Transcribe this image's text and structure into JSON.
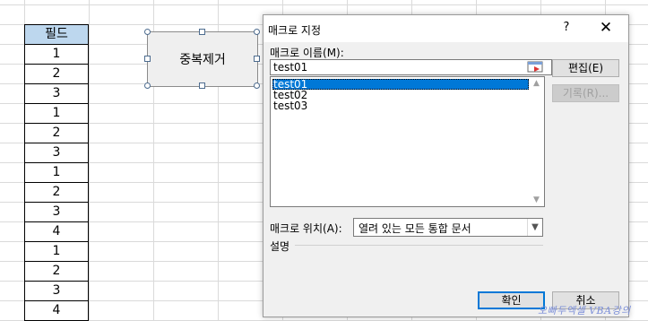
{
  "sheet": {
    "field_header": "필드",
    "field_values": [
      "1",
      "2",
      "3",
      "1",
      "2",
      "3",
      "1",
      "2",
      "3",
      "4",
      "1",
      "2",
      "3",
      "4"
    ]
  },
  "shape": {
    "label": "중복제거"
  },
  "dialog": {
    "title": "매크로 지정",
    "help": "?",
    "close": "✕",
    "macro_name_label": "매크로 이름(M):",
    "macro_name_value": "test01",
    "macros": [
      "test01",
      "test02",
      "test03"
    ],
    "selected_index": 0,
    "edit_button": "편집(E)",
    "record_button": "기록(R)...",
    "location_label": "매크로 위치(A):",
    "location_value": "열려 있는 모든 통합 문서",
    "description_label": "설명",
    "ok_button": "확인",
    "cancel_button": "취소"
  },
  "watermark": "오빠두엑셀 VBA강의",
  "colors": {
    "header_fill": "#bdd7ee",
    "selection": "#0078d7"
  }
}
